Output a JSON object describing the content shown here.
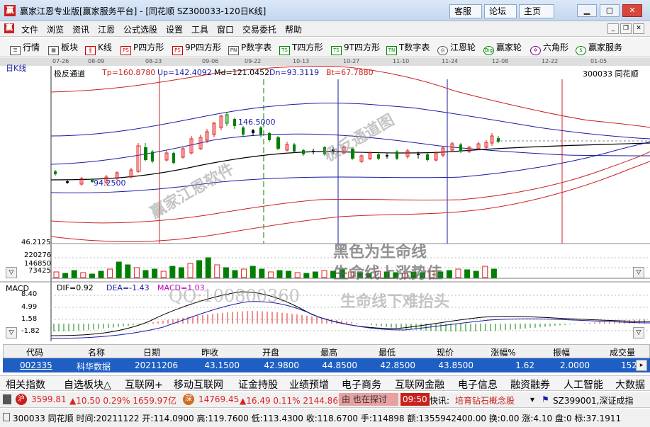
{
  "window": {
    "title": "赢家江恩专业版[赢家服务平台] - [同花顺  SZ300033-120日K线]",
    "service_buttons": [
      "客服",
      "论坛",
      "主页"
    ]
  },
  "menu": [
    "文件",
    "浏览",
    "资讯",
    "江恩",
    "公式选股",
    "设置",
    "工具",
    "窗口",
    "交易委托",
    "帮助"
  ],
  "toolbar": [
    {
      "icon": "quote-icon",
      "label": "行情"
    },
    {
      "icon": "sector-icon",
      "label": "板块"
    },
    {
      "icon": "candlestick-icon",
      "label": "K线"
    },
    {
      "icon": "ps-icon",
      "label": "P四方形"
    },
    {
      "icon": "ps-icon",
      "label": "9P四方形"
    },
    {
      "icon": "pn-icon",
      "label": "P数字表"
    },
    {
      "icon": "ts-icon",
      "label": "T四方形"
    },
    {
      "icon": "ts-icon",
      "label": "9T四方形"
    },
    {
      "icon": "tn-icon",
      "label": "T数字表"
    },
    {
      "icon": "gann-wheel-icon",
      "label": "江恩轮"
    },
    {
      "icon": "big-wheel-icon",
      "label": "赢家轮"
    },
    {
      "icon": "hexagon-icon",
      "label": "六角形"
    },
    {
      "icon": "dollar-icon",
      "label": "赢家服务"
    }
  ],
  "chart": {
    "period_label": "日K线",
    "date_ticks": [
      "07-26",
      "08-09",
      "08-23",
      "09-06",
      "09-22",
      "10-13",
      "10-27",
      "11-10",
      "11-24",
      "12-08",
      "12-22",
      "01-05"
    ],
    "indicator_name": "极反通道",
    "tp": "Tp=160.8780",
    "up": "Up=142.4092",
    "md": "Md=121.0452",
    "dn": "Dn=93.3119",
    "bt": "Bt=67.7880",
    "stock": "300033  同花顺",
    "high_label": "146.5000",
    "low_label": "94.2500",
    "price_bottom_label": "46.2125",
    "volume_ticks": [
      "220276",
      "146850",
      "73425"
    ],
    "macd_title": "MACD",
    "dif": "DIF=0.92",
    "dea": "DEA=-1.43",
    "macd": "MACD=1.03",
    "macd_ticks": [
      "8.40",
      "4.99",
      "1.58",
      "-1.82"
    ]
  },
  "watermarks": {
    "w1": "赢家江恩软件",
    "w2": "极反通道图",
    "w3": "黑色为生命线",
    "w4": "生命线上涨势佳",
    "w5": "QQ:100800360",
    "w6": "生命线下难抬头"
  },
  "quote_table": {
    "headers": [
      "代码",
      "名称",
      "日期",
      "昨收",
      "开盘",
      "最高",
      "最低",
      "现价",
      "涨幅%",
      "振幅",
      "成交量"
    ],
    "row": [
      "002335",
      "科华数据",
      "20211206",
      "43.1500",
      "42.9800",
      "44.8500",
      "42.8500",
      "43.8500",
      "1.62",
      "2.0000",
      "152"
    ]
  },
  "sectors": [
    "相关指数",
    "自选板块△",
    "互联网+",
    "移动互联网",
    "证金持股",
    "业绩预增",
    "电子商务",
    "互联网金融",
    "电子信息",
    "融资融券",
    "人工智能",
    "大数据"
  ],
  "status": {
    "sh_badge": "沪",
    "sh": "3599.81",
    "sh_chg": "▲10.50 0.29% 1659.97亿",
    "sz_badge": "深",
    "sz": "14769.45",
    "sz_chg": "▲16.49 0.11% 2144.86亿",
    "news_title": "由 也在探讨",
    "time": "09:50",
    "flash_label": "快讯:",
    "flash_text": "培育钻石概念股",
    "right_code": "SZ399001,深证成指"
  },
  "bottom_info": "300033 同花顺 时间:20211122 开:114.0900 高:119.7600 低:113.4300 收:118.6700 手:114898 额:1355942400.00 换:0.00 涨:4.10 盘:0 标:37.1911",
  "colors": {
    "up": "#e02020",
    "down": "#008000",
    "channel_red": "#cc2020",
    "channel_blue": "#1a1aa8",
    "midline": "#000000"
  }
}
